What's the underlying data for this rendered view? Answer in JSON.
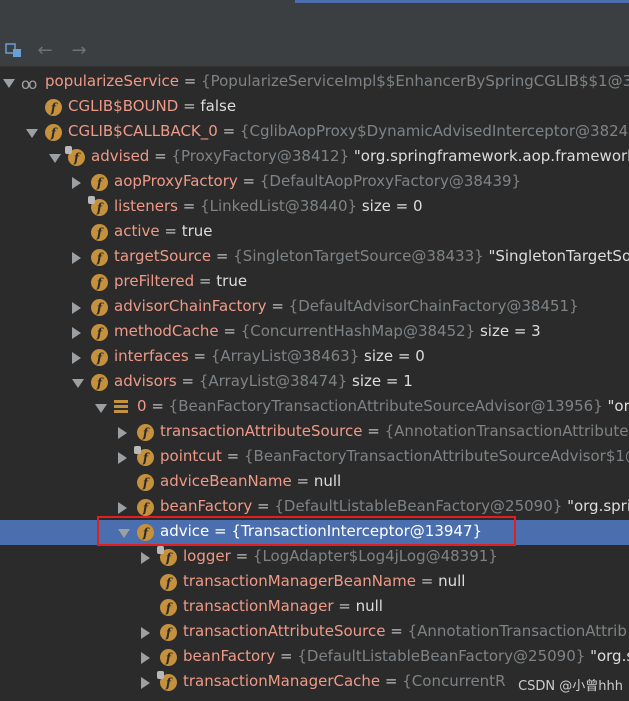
{
  "toolbar": {
    "icons": [
      "watch-icon",
      "back-arrow-icon",
      "forward-arrow-icon"
    ]
  },
  "tree": [
    {
      "id": "r0",
      "indent": 0,
      "arrow": "down",
      "icon": "glasses",
      "name": "popularizeService",
      "eq": " = ",
      "ref": "{PopularizeServiceImpl$$EnhancerBySpringCGLIB$$1@38",
      "val": ""
    },
    {
      "id": "r1",
      "indent": 1,
      "arrow": "",
      "icon": "field",
      "name": "CGLIB$BOUND",
      "eq": " = ",
      "ref": "",
      "val": "false"
    },
    {
      "id": "r2",
      "indent": 1,
      "arrow": "down",
      "icon": "field",
      "name": "CGLIB$CALLBACK_0",
      "eq": " = ",
      "ref": "{CglibAopProxy$DynamicAdvisedInterceptor@3824",
      "val": ""
    },
    {
      "id": "r3",
      "indent": 2,
      "arrow": "down",
      "icon": "field-lock",
      "name": "advised",
      "eq": " = ",
      "ref": "{ProxyFactory@38412}",
      "val": " \"org.springframework.aop.framework"
    },
    {
      "id": "r4",
      "indent": 3,
      "arrow": "right",
      "icon": "field",
      "name": "aopProxyFactory",
      "eq": " = ",
      "ref": "{DefaultAopProxyFactory@38439}",
      "val": ""
    },
    {
      "id": "r5",
      "indent": 3,
      "arrow": "",
      "icon": "field-lock",
      "name": "listeners",
      "eq": " = ",
      "ref": "{LinkedList@38440}",
      "val": "  size = 0"
    },
    {
      "id": "r6",
      "indent": 3,
      "arrow": "",
      "icon": "field",
      "name": "active",
      "eq": " = ",
      "ref": "",
      "val": "true"
    },
    {
      "id": "r7",
      "indent": 3,
      "arrow": "right",
      "icon": "field",
      "name": "targetSource",
      "eq": " = ",
      "ref": "{SingletonTargetSource@38433}",
      "val": " \"SingletonTargetSo"
    },
    {
      "id": "r8",
      "indent": 3,
      "arrow": "",
      "icon": "field",
      "name": "preFiltered",
      "eq": " = ",
      "ref": "",
      "val": "true"
    },
    {
      "id": "r9",
      "indent": 3,
      "arrow": "right",
      "icon": "field",
      "name": "advisorChainFactory",
      "eq": " = ",
      "ref": "{DefaultAdvisorChainFactory@38451}",
      "val": ""
    },
    {
      "id": "r10",
      "indent": 3,
      "arrow": "right",
      "icon": "field",
      "name": "methodCache",
      "eq": " = ",
      "ref": "{ConcurrentHashMap@38452}",
      "val": "  size = 3"
    },
    {
      "id": "r11",
      "indent": 3,
      "arrow": "right",
      "icon": "field",
      "name": "interfaces",
      "eq": " = ",
      "ref": "{ArrayList@38463}",
      "val": "  size = 0"
    },
    {
      "id": "r12",
      "indent": 3,
      "arrow": "down",
      "icon": "field",
      "name": "advisors",
      "eq": " = ",
      "ref": "{ArrayList@38474}",
      "val": "  size = 1"
    },
    {
      "id": "r13",
      "indent": 4,
      "arrow": "down",
      "icon": "array",
      "name": "0",
      "eq": " = ",
      "ref": "{BeanFactoryTransactionAttributeSourceAdvisor@13956}",
      "val": " \"org"
    },
    {
      "id": "r14",
      "indent": 5,
      "arrow": "right",
      "icon": "field",
      "name": "transactionAttributeSource",
      "eq": " = ",
      "ref": "{AnnotationTransactionAttribute",
      "val": ""
    },
    {
      "id": "r15",
      "indent": 5,
      "arrow": "right",
      "icon": "field-lock",
      "name": "pointcut",
      "eq": " = ",
      "ref": "{BeanFactoryTransactionAttributeSourceAdvisor$1@",
      "val": ""
    },
    {
      "id": "r16",
      "indent": 5,
      "arrow": "",
      "icon": "field",
      "name": "adviceBeanName",
      "eq": " = ",
      "ref": "",
      "val": "null"
    },
    {
      "id": "r17",
      "indent": 5,
      "arrow": "right",
      "icon": "field",
      "name": "beanFactory",
      "eq": " = ",
      "ref": "{DefaultListableBeanFactory@25090}",
      "val": " \"org.sprin"
    },
    {
      "id": "r18",
      "indent": 5,
      "arrow": "down",
      "icon": "field",
      "name": "advice",
      "eq": " = ",
      "ref": "{TransactionInterceptor@13947}",
      "val": "",
      "selected": true
    },
    {
      "id": "r19",
      "indent": 6,
      "arrow": "right",
      "icon": "field-lock",
      "name": "logger",
      "eq": " = ",
      "ref": "{LogAdapter$Log4jLog@48391}",
      "val": ""
    },
    {
      "id": "r20",
      "indent": 6,
      "arrow": "",
      "icon": "field",
      "name": "transactionManagerBeanName",
      "eq": " = ",
      "ref": "",
      "val": "null"
    },
    {
      "id": "r21",
      "indent": 6,
      "arrow": "",
      "icon": "field",
      "name": "transactionManager",
      "eq": " = ",
      "ref": "",
      "val": "null"
    },
    {
      "id": "r22",
      "indent": 6,
      "arrow": "right",
      "icon": "field",
      "name": "transactionAttributeSource",
      "eq": " = ",
      "ref": "{AnnotationTransactionAttrib",
      "val": ""
    },
    {
      "id": "r23",
      "indent": 6,
      "arrow": "right",
      "icon": "field",
      "name": "beanFactory",
      "eq": " = ",
      "ref": "{DefaultListableBeanFactory@25090}",
      "val": " \"org.sp"
    },
    {
      "id": "r24",
      "indent": 6,
      "arrow": "right",
      "icon": "field-lock",
      "name": "transactionManagerCache",
      "eq": " = ",
      "ref": "{ConcurrentR",
      "val": ""
    }
  ],
  "watermark": "CSDN @小曾hhh"
}
